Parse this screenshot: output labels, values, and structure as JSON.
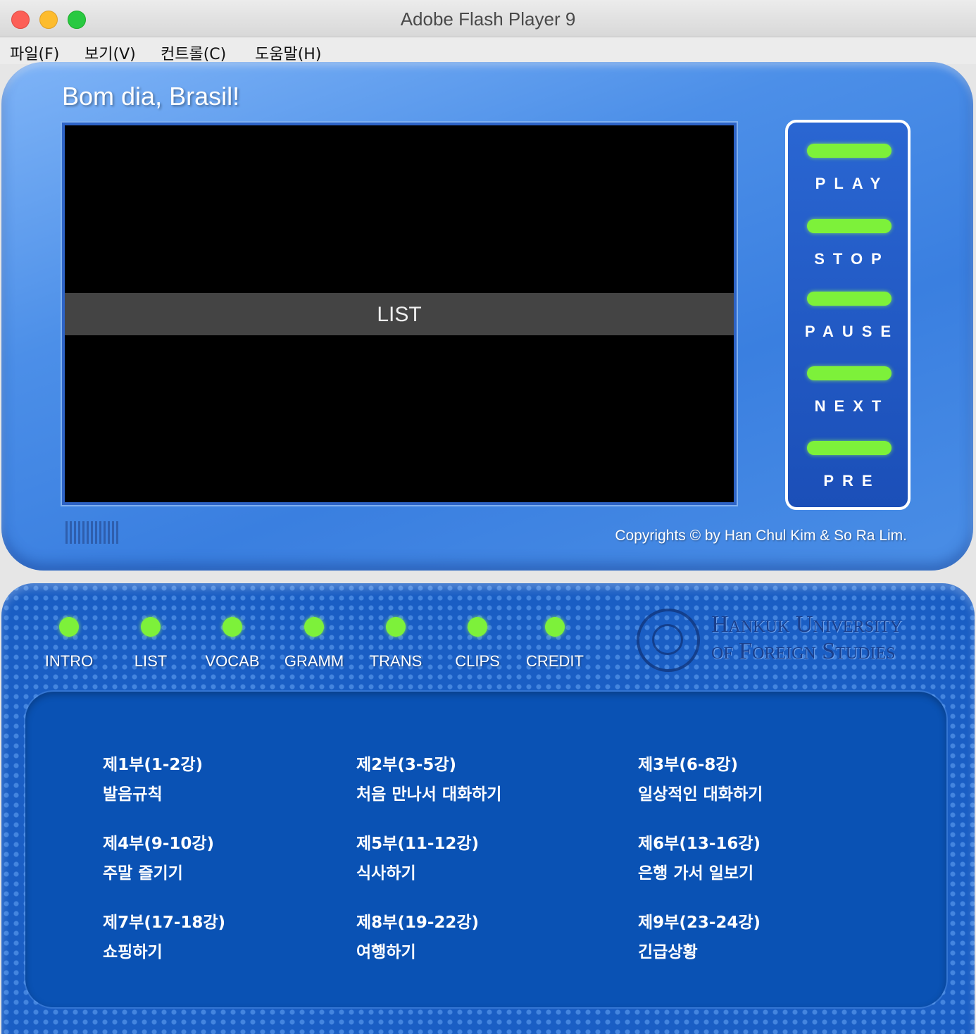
{
  "window": {
    "title": "Adobe Flash Player 9"
  },
  "menu": {
    "items": [
      "파일(F)",
      "보기(V)",
      "컨트롤(C)",
      "도움말(H)"
    ]
  },
  "player": {
    "title": "Bom dia, Brasil!",
    "screen_label": "LIST",
    "copyright": "Copyrights © by Han Chul Kim & So Ra Lim."
  },
  "controls": [
    "PLAY",
    "STOP",
    "PAUSE",
    "NEXT",
    "PRE"
  ],
  "nav": [
    "INTRO",
    "LIST",
    "VOCAB",
    "GRAMM",
    "TRANS",
    "CLIPS",
    "CREDIT"
  ],
  "logo": {
    "line1": "Hankuk University",
    "line2": "of Foreign Studies"
  },
  "lessons": [
    {
      "part": "제1부(1-2강)",
      "title": "발음규칙"
    },
    {
      "part": "제2부(3-5강)",
      "title": "처음 만나서 대화하기"
    },
    {
      "part": "제3부(6-8강)",
      "title": "일상적인 대화하기"
    },
    {
      "part": "제4부(9-10강)",
      "title": "주말 즐기기"
    },
    {
      "part": "제5부(11-12강)",
      "title": "식사하기"
    },
    {
      "part": "제6부(13-16강)",
      "title": "은행 가서 일보기"
    },
    {
      "part": "제7부(17-18강)",
      "title": "쇼핑하기"
    },
    {
      "part": "제8부(19-22강)",
      "title": "여행하기"
    },
    {
      "part": "제9부(23-24강)",
      "title": "긴급상황"
    }
  ],
  "colors": {
    "accent_green": "#7df13a",
    "panel_blue": "#1a5ec4",
    "player_blue": "#4c8fe8"
  }
}
